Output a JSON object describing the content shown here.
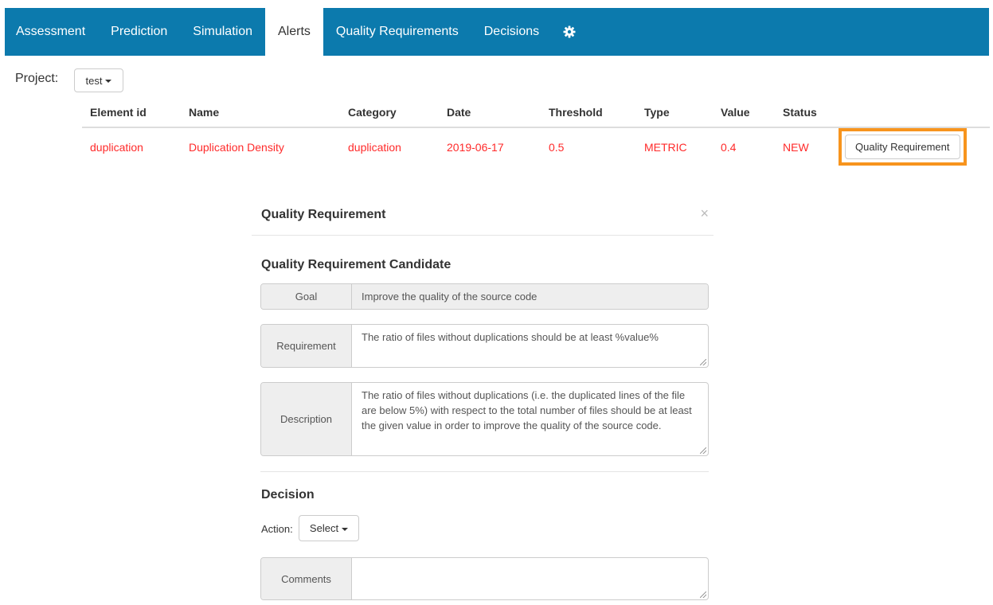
{
  "nav": {
    "items": [
      {
        "label": "Assessment",
        "active": false
      },
      {
        "label": "Prediction",
        "active": false
      },
      {
        "label": "Simulation",
        "active": false
      },
      {
        "label": "Alerts",
        "active": true
      },
      {
        "label": "Quality Requirements",
        "active": false
      },
      {
        "label": "Decisions",
        "active": false
      }
    ],
    "settings_icon": "gear-icon",
    "bar_color": "#0c7aad"
  },
  "project": {
    "label": "Project:",
    "selected": "test"
  },
  "alerts_table": {
    "columns": [
      "Element id",
      "Name",
      "Category",
      "Date",
      "Threshold",
      "Type",
      "Value",
      "Status"
    ],
    "rows": [
      {
        "element_id": "duplication",
        "name": "Duplication Density",
        "category": "duplication",
        "date": "2019-06-17",
        "threshold": "0.5",
        "type": "METRIC",
        "value": "0.4",
        "status": "NEW",
        "action_label": "Quality Requirement"
      }
    ],
    "row_color": "#ff2a2a",
    "highlight_color": "#f7941d"
  },
  "modal": {
    "title": "Quality Requirement",
    "close_symbol": "×",
    "candidate_title": "Quality Requirement Candidate",
    "goal": {
      "label": "Goal",
      "value": "Improve the quality of the source code"
    },
    "requirement": {
      "label": "Requirement",
      "value": "The ratio of files without duplications should be at least %value%"
    },
    "description": {
      "label": "Description",
      "value": "The ratio of files without duplications (i.e. the duplicated lines of the file are below 5%) with respect to the total number of files should be at least the given value in order to improve the quality of the source code."
    },
    "decision_title": "Decision",
    "action": {
      "label": "Action:",
      "selected": "Select"
    },
    "comments": {
      "label": "Comments",
      "value": ""
    }
  }
}
